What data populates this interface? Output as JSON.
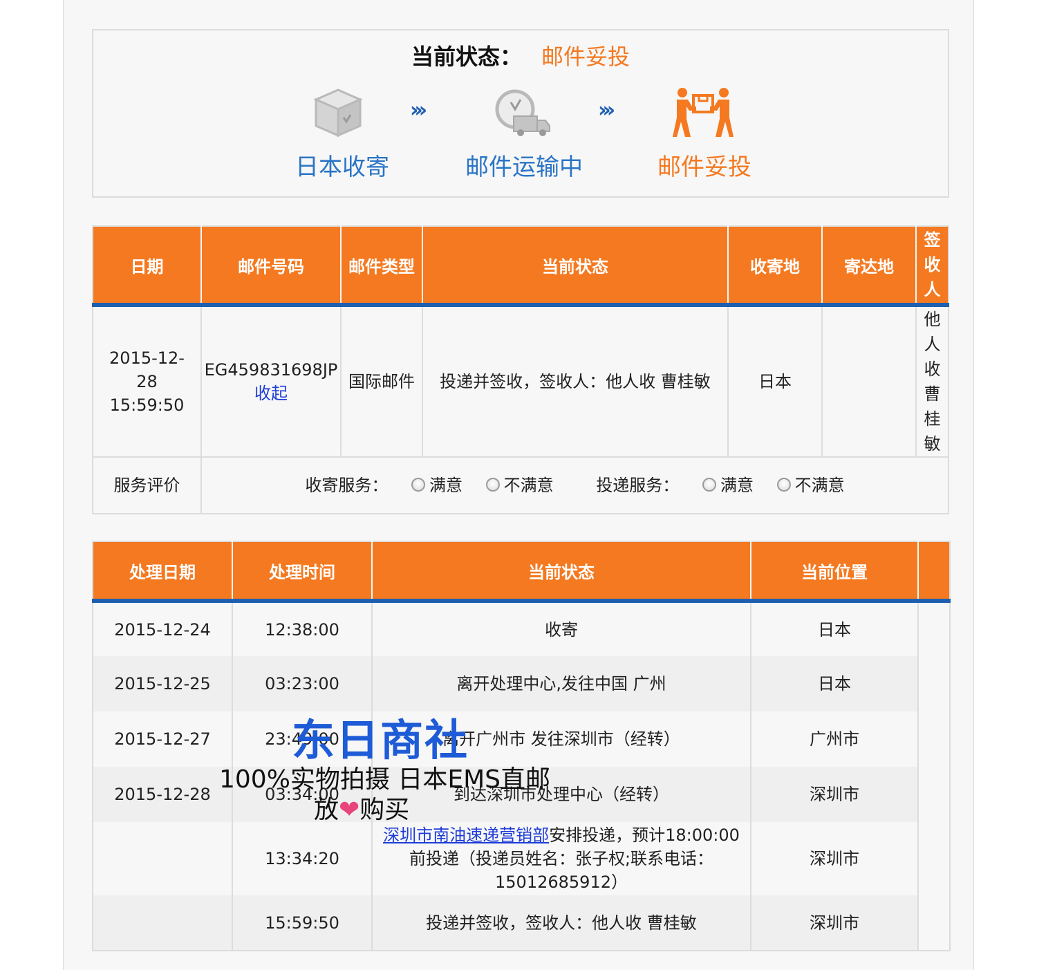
{
  "status": {
    "label": "当前状态：",
    "value": "邮件妥投",
    "steps": [
      {
        "label": "日本收寄",
        "icon": "box-icon",
        "color": "#2a74c6"
      },
      {
        "label": "邮件运输中",
        "icon": "truck-clock-icon",
        "color": "#2a74c6"
      },
      {
        "label": "邮件妥投",
        "icon": "delivery-people-icon",
        "color": "#f47920"
      }
    ],
    "arrow": "›››"
  },
  "main_table": {
    "headers": [
      "日期",
      "邮件号码",
      "邮件类型",
      "当前状态",
      "收寄地",
      "寄达地",
      "签收人"
    ],
    "row": {
      "date": "2015-12-28 15:59:50",
      "tracking_no": "EG459831698JP",
      "collapse_link": "收起",
      "type": "国际邮件",
      "status": "投递并签收，签收人：他人收 曹桂敏",
      "origin": "日本",
      "destination": "",
      "signer": "他人收曹桂敏"
    },
    "rating": {
      "label": "服务评价",
      "collect_label": "收寄服务：",
      "deliver_label": "投递服务：",
      "satisfied": "满意",
      "unsatisfied": "不满意"
    }
  },
  "track_table": {
    "headers": [
      "处理日期",
      "处理时间",
      "当前状态",
      "当前位置",
      ""
    ],
    "rows": [
      {
        "date": "2015-12-24",
        "time": "12:38:00",
        "status": "收寄",
        "location": "日本"
      },
      {
        "date": "2015-12-25",
        "time": "03:23:00",
        "status": "离开处理中心,发往中国 广州",
        "location": "日本"
      },
      {
        "date": "2015-12-27",
        "time": "23:49:00",
        "status": "离开广州市 发往深圳市（经转）",
        "location": "广州市"
      },
      {
        "date": "2015-12-28",
        "time": "03:34:00",
        "status": "到达深圳市处理中心（经转）",
        "location": "深圳市"
      },
      {
        "date": "",
        "time": "13:34:20",
        "status_link": "深圳市南油速递营销部",
        "status": "安排投递，预计18:00:00前投递（投递员姓名：张子权;联系电话：15012685912）",
        "location": "深圳市"
      },
      {
        "date": "",
        "time": "15:59:50",
        "status": "投递并签收，签收人：他人收 曹桂敏",
        "location": "深圳市"
      }
    ]
  },
  "watermark": {
    "line1": "东日商社",
    "line2": "100%实物拍摄 日本EMS直邮",
    "line3_a": "放",
    "line3_b": "购买",
    "heart": "❤"
  }
}
